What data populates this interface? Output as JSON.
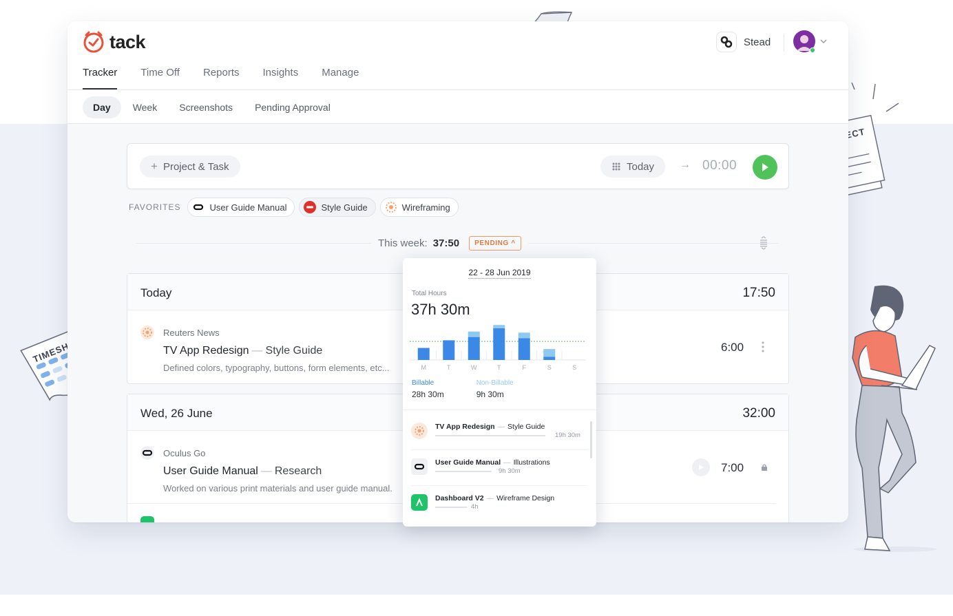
{
  "app": {
    "logo_text": "tack",
    "workspace": "Stead"
  },
  "main_nav": [
    {
      "label": "Tracker",
      "active": true
    },
    {
      "label": "Time Off"
    },
    {
      "label": "Reports"
    },
    {
      "label": "Insights"
    },
    {
      "label": "Manage"
    }
  ],
  "sub_nav": [
    {
      "label": "Day",
      "active": true
    },
    {
      "label": "Week"
    },
    {
      "label": "Screenshots"
    },
    {
      "label": "Pending Approval"
    }
  ],
  "timer": {
    "project_task_label": "Project & Task",
    "date_label": "Today",
    "time": "00:00"
  },
  "favorites": {
    "label": "FAVORITES",
    "items": [
      {
        "label": "User Guide Manual",
        "icon": "oculus-icon"
      },
      {
        "label": "Style Guide",
        "icon": "jumbo-icon"
      },
      {
        "label": "Wireframing",
        "icon": "reuters-icon"
      }
    ]
  },
  "week": {
    "label": "This week:",
    "total": "37:50",
    "status": "PENDING"
  },
  "days": [
    {
      "title": "Today",
      "total": "17:50",
      "entry": {
        "client": "Reuters News",
        "project": "TV App Redesign",
        "task": "Style Guide",
        "description": "Defined colors, typography, buttons, form elements, etc...",
        "duration": "6:00"
      }
    },
    {
      "title": "Wed, 26 June",
      "total": "32:00",
      "entry": {
        "client": "Oculus Go",
        "project": "User Guide Manual",
        "task": "Research",
        "description": "Worked on various print materials and user guide manual.",
        "duration": "7:00"
      }
    }
  ],
  "popover": {
    "range": "22 - 28 Jun 2019",
    "total_label": "Total Hours",
    "total_value": "37h 30m",
    "billable_label": "Billable",
    "billable_value": "28h 30m",
    "nonbillable_label": "Non-Billable",
    "nonbillable_value": "9h 30m",
    "projects": [
      {
        "project": "TV App Redesign",
        "task": "Style Guide",
        "hours": "19h 30m",
        "share": 0.78
      },
      {
        "project": "User Guide Manual",
        "task": "Illustrations",
        "hours": "9h 30m",
        "share": 0.4
      },
      {
        "project": "Dashboard V2",
        "task": "Wireframe Design",
        "hours": "4h",
        "share": 0.2
      }
    ]
  },
  "chart_data": {
    "type": "bar",
    "categories": [
      "M",
      "T",
      "W",
      "T",
      "F",
      "S",
      "S"
    ],
    "series": [
      {
        "name": "Billable",
        "values": [
          5.5,
          9,
          10.5,
          14.5,
          10,
          1.5,
          0
        ]
      },
      {
        "name": "Non-Billable",
        "values": [
          0,
          0,
          2.5,
          1.5,
          2.5,
          3.5,
          0
        ]
      }
    ],
    "ylim": [
      0,
      17
    ],
    "colors": {
      "Billable": "#3b88e6",
      "Non-Billable": "#8ec9f0"
    }
  },
  "illustrations": {
    "timesheet_label": "TIMESHEET",
    "project_label": "PROJECT"
  }
}
